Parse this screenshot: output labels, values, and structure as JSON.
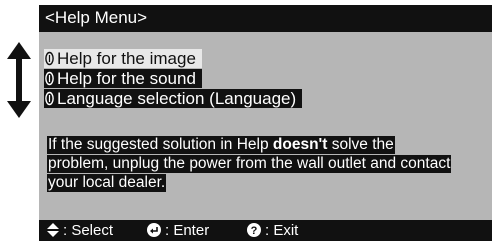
{
  "window": {
    "title": "<Help Menu>"
  },
  "menu": {
    "items": [
      {
        "label": "Help for the image",
        "selected": true,
        "icon": "help-item-icon"
      },
      {
        "label": "Help for the sound",
        "selected": false,
        "icon": "help-item-icon"
      },
      {
        "label": "Language selection (Language)",
        "selected": false,
        "icon": "help-item-icon"
      }
    ]
  },
  "message": {
    "line1_pre": "If the suggested solution in Help ",
    "line1_bold": "doesn't",
    "line1_post": " solve the",
    "line2": "problem, unplug the power from the wall outlet and contact",
    "line3": "your local dealer."
  },
  "footer": {
    "select_label": ": Select",
    "enter_label": ": Enter",
    "exit_label": ": Exit"
  },
  "colors": {
    "osd_background": "#b6b6b6",
    "bar_black": "#111111",
    "selected_highlight": "#e8e8e8",
    "text_white": "#ffffff"
  }
}
